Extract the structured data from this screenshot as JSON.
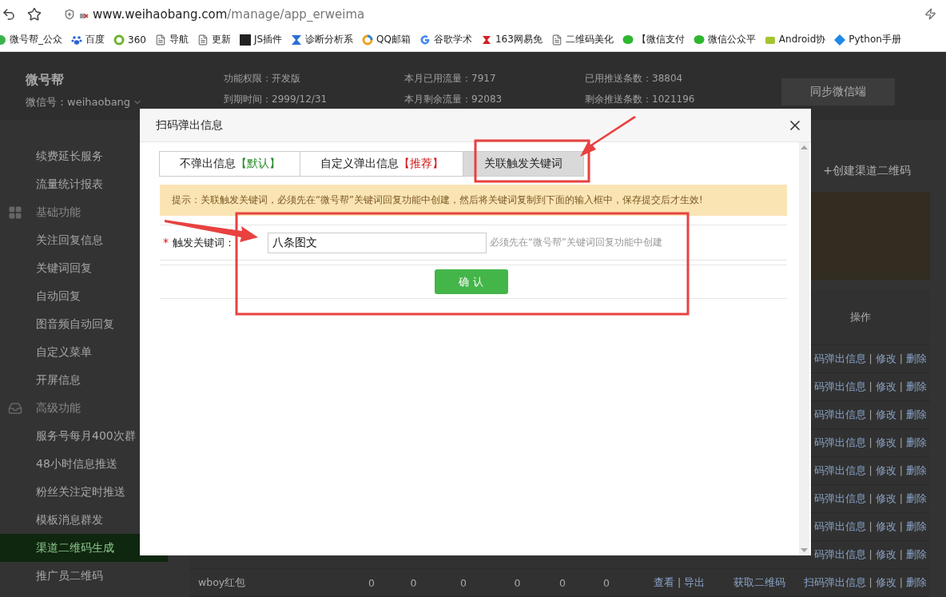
{
  "browser": {
    "host": "www.weihaobang.com",
    "path": "/manage/app_erweima"
  },
  "bookmarks": [
    {
      "label": "微号帮_公众",
      "kind": "dot"
    },
    {
      "label": "百度",
      "kind": "paw"
    },
    {
      "label": "360",
      "kind": "ring"
    },
    {
      "label": "导航",
      "kind": "page"
    },
    {
      "label": "更新",
      "kind": "page"
    },
    {
      "label": "JS插件",
      "kind": "square"
    },
    {
      "label": "诊断分析系",
      "kind": "hourglass"
    },
    {
      "label": "QQ邮箱",
      "kind": "qq"
    },
    {
      "label": "谷歌学术",
      "kind": "g"
    },
    {
      "label": "163网易免",
      "kind": "red"
    },
    {
      "label": "二维码美化",
      "kind": "page"
    },
    {
      "label": "【微信支付",
      "kind": "chat"
    },
    {
      "label": "微信公众平",
      "kind": "chat"
    },
    {
      "label": "Android协",
      "kind": "android"
    },
    {
      "label": "Python手册",
      "kind": "diamond"
    }
  ],
  "header": {
    "brand": "微号帮",
    "account": "微信号：weihaobang",
    "info": [
      "功能权限：开发版",
      "本月已用流量：7917",
      "已用推送条数：38804",
      "到期时间：2999/12/31",
      "本月剩余流量：92083",
      "剩余推送条数：1021196"
    ],
    "sync_button": "同步微信端"
  },
  "sidebar": [
    {
      "kind": "item",
      "label": "续费延长服务",
      "selected": false
    },
    {
      "kind": "item",
      "label": "流量统计报表",
      "selected": false
    },
    {
      "kind": "section",
      "label": "基础功能"
    },
    {
      "kind": "item",
      "label": "关注回复信息",
      "selected": false
    },
    {
      "kind": "item",
      "label": "关键词回复",
      "selected": false
    },
    {
      "kind": "item",
      "label": "自动回复",
      "selected": false
    },
    {
      "kind": "item",
      "label": "图音频自动回复",
      "selected": false
    },
    {
      "kind": "item",
      "label": "自定义菜单",
      "selected": false
    },
    {
      "kind": "item",
      "label": "开屏信息",
      "selected": false
    },
    {
      "kind": "section",
      "label": "高级功能"
    },
    {
      "kind": "item",
      "label": "服务号每月400次群",
      "selected": false
    },
    {
      "kind": "item",
      "label": "48小时信息推送",
      "selected": false
    },
    {
      "kind": "item",
      "label": "粉丝关注定时推送",
      "selected": false
    },
    {
      "kind": "item",
      "label": "模板消息群发",
      "selected": false
    },
    {
      "kind": "item",
      "label": "渠道二维码生成",
      "selected": true
    },
    {
      "kind": "item",
      "label": "推广员二维码",
      "selected": false
    }
  ],
  "create_link": "+创建渠道二维码",
  "table": {
    "columns": [
      {
        "label": "操作"
      }
    ],
    "separator": "|",
    "rows": [
      {
        "cells": [],
        "actions": [
          "码弹出信息",
          "修改",
          "删除"
        ]
      },
      {
        "cells": [],
        "actions": [
          "码弹出信息",
          "修改",
          "删除"
        ]
      },
      {
        "cells": [],
        "actions": [
          "码弹出信息",
          "修改",
          "删除"
        ]
      },
      {
        "cells": [],
        "actions": [
          "码弹出信息",
          "修改",
          "删除"
        ]
      },
      {
        "cells": [],
        "actions": [
          "码弹出信息",
          "修改",
          "删除"
        ]
      },
      {
        "cells": [],
        "actions": [
          "码弹出信息",
          "修改",
          "删除"
        ]
      },
      {
        "cells": [],
        "actions": [
          "码弹出信息",
          "修改",
          "删除"
        ]
      },
      {
        "cells": [],
        "actions": [
          "码弹出信息",
          "修改",
          "删除"
        ]
      },
      {
        "cells": [
          "wboy红包",
          "0",
          "0",
          "0",
          "0",
          "0",
          "0"
        ],
        "links": [
          "查看",
          "导出"
        ],
        "qrcode": "获取二维码",
        "actions": [
          "扫码弹出信息",
          "修改",
          "删除"
        ]
      }
    ]
  },
  "modal": {
    "title": "扫码弹出信息",
    "tabs": [
      {
        "label": "不弹出信息",
        "tag": "【默认】",
        "color": "#2a8a2a",
        "selected": false
      },
      {
        "label": "自定义弹出信息",
        "tag": "【推荐】",
        "color": "#d11a1a",
        "selected": false
      },
      {
        "label": "关联触发关键词",
        "selected": true
      }
    ],
    "tip": "提示：关联触发关键词，必须先在“微号帮”关键词回复功能中创建，然后将关键词复制到下面的输入框中，保存提交后才生效!",
    "field": {
      "required_mark": "*",
      "label": "触发关键词：",
      "value": "八条图文",
      "hint": "必须先在“微号帮”关键词回复功能中创建"
    },
    "confirm": "确 认"
  }
}
